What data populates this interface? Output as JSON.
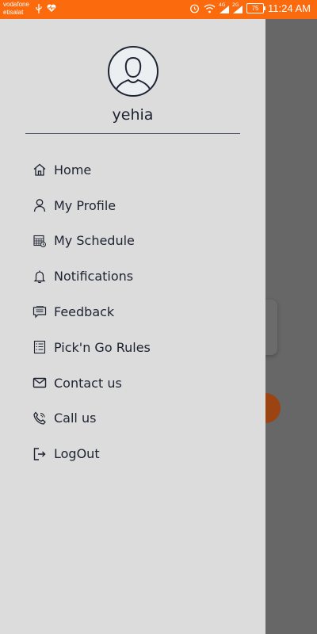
{
  "status_bar": {
    "carrier_1": "vodafone",
    "carrier_2": "etisalat",
    "signal_2_label": "4G",
    "signal_3_label": "2G",
    "battery": "75",
    "time": "11:24 AM",
    "background_color": "#fb6a0d"
  },
  "drawer": {
    "username": "yehia",
    "menu": [
      {
        "label": "Home",
        "icon": "home-icon"
      },
      {
        "label": "My Profile",
        "icon": "profile-icon"
      },
      {
        "label": "My Schedule",
        "icon": "schedule-icon"
      },
      {
        "label": "Notifications",
        "icon": "bell-icon"
      },
      {
        "label": "Feedback",
        "icon": "feedback-icon"
      },
      {
        "label": "Pick'n Go Rules",
        "icon": "rules-list-icon"
      },
      {
        "label": "Contact us",
        "icon": "mail-icon"
      },
      {
        "label": "Call us",
        "icon": "phone-icon"
      },
      {
        "label": "LogOut",
        "icon": "logout-icon"
      }
    ]
  },
  "colors": {
    "drawer_bg": "#dcdcdc",
    "text": "#1c2230",
    "overlay": "#676767",
    "accent": "#fb6a0d"
  }
}
